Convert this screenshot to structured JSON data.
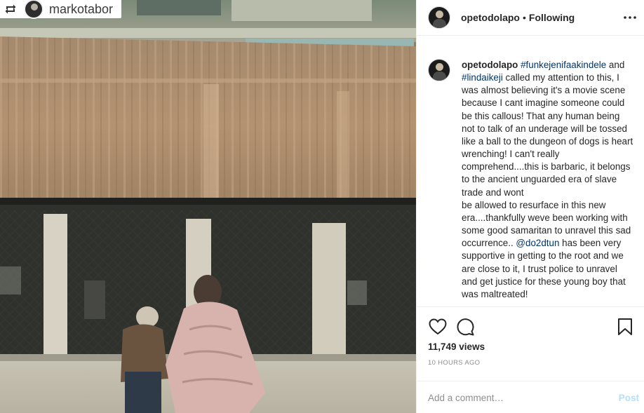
{
  "media": {
    "repost_icon": "repost-icon",
    "repost_username": "markotabor"
  },
  "header": {
    "username": "opetodolapo",
    "separator": "•",
    "follow_status": "Following",
    "more_icon": "more-horizontal-icon"
  },
  "caption": {
    "username": "opetodolapo",
    "mention_1": "#funkejenifaakindele",
    "joiner_1": "and",
    "mention_2": "#lindaikeji",
    "text_1": "called my attention to this, I was almost believing it's a movie scene because I cant imagine someone could be this callous! That any human being not to talk of an underage will be tossed like a ball to the dungeon of dogs is heart wrenching! I can't really comprehend....this is barbaric, it belongs to the ancient unguarded era of slave trade and wont",
    "text_2": "be allowed to resurface in this new era....thankfully weve been working with some good samaritan to unravel this sad occurrence..",
    "mention_3": "@do2dtun",
    "text_3": "has been very supportive in getting to the root and we are close to it, I trust police to unravel and get justice for these young boy that was maltreated!"
  },
  "actions": {
    "like_icon": "heart-icon",
    "comment_icon": "speech-bubble-icon",
    "save_icon": "bookmark-icon",
    "views": "11,749 views",
    "time_ago": "10 HOURS AGO"
  },
  "comment_box": {
    "placeholder": "Add a comment…",
    "post_label": "Post",
    "post_color": "#b2dffc"
  },
  "colors": {
    "link": "#003569",
    "text": "#262626",
    "secondary": "#8e8e8e",
    "border": "#efefef"
  }
}
